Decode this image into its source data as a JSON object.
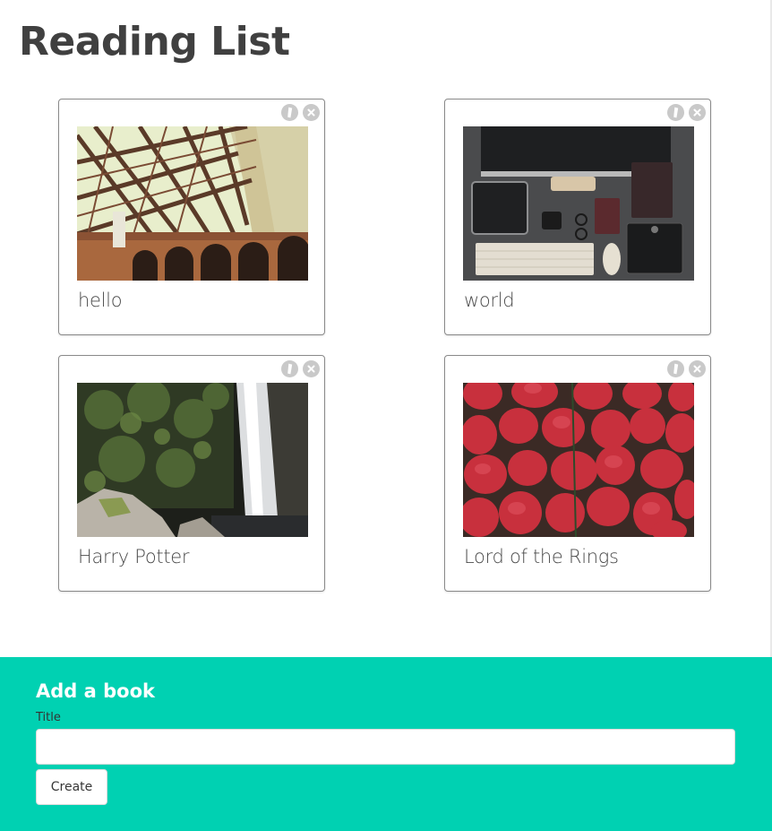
{
  "header": {
    "title": "Reading List"
  },
  "books": [
    {
      "title": "hello",
      "image": "bridge-photo"
    },
    {
      "title": "world",
      "image": "desk-setup-photo"
    },
    {
      "title": "Harry Potter",
      "image": "waterfall-photo"
    },
    {
      "title": "Lord of the Rings",
      "image": "strawberries-photo"
    }
  ],
  "card_controls": {
    "edit_icon": "pencil-icon",
    "delete_icon": "close-icon"
  },
  "form": {
    "heading": "Add a book",
    "title_label": "Title",
    "title_value": "",
    "create_label": "Create"
  },
  "colors": {
    "accent": "#00d1b2",
    "heading": "#404040",
    "control": "#c9c9c9"
  }
}
